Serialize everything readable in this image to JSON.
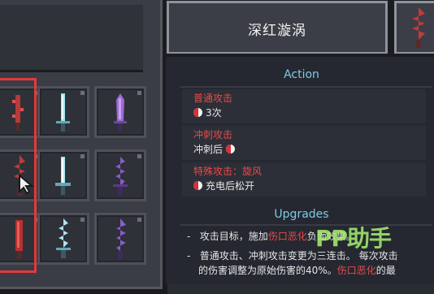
{
  "title": "深红漩涡",
  "action_header": "Action",
  "actions": [
    {
      "title": "普通攻击",
      "desc": "3次",
      "dot_before": true
    },
    {
      "title": "冲刺攻击",
      "desc": "冲刺后",
      "dot_after": true
    },
    {
      "title": "特殊攻击：旋风",
      "desc": "充电后松开",
      "dot_before": true
    }
  ],
  "upgrades_header": "Upgrades",
  "upgrades": [
    {
      "bullet": "-",
      "pre": "攻击目标，施加",
      "red": "伤口恶化",
      "post": "负面效果。"
    },
    {
      "bullet": "-",
      "pre": "普通攻击、冲刺攻击变更为三连击。 每次攻击",
      "red": "",
      "post": ""
    },
    {
      "bullet": "",
      "pre": "的伤害调整为原始伤害的40%。",
      "red": "伤口恶化",
      "post": "的最"
    }
  ],
  "watermark": "PP助手",
  "colors": {
    "accent_red": "#e94a4a",
    "accent_blue": "#7fc9e8",
    "selection_frame": "#e03a3a"
  },
  "inventory": {
    "weapons": [
      {
        "icon": "crimson-blade-icon",
        "color": "#b83a3a"
      },
      {
        "icon": "ice-sword-icon",
        "color": "#9fe4f0"
      },
      {
        "icon": "purple-dagger-icon",
        "color": "#9d6ad6"
      },
      {
        "icon": "crimson-vortex-sword-icon",
        "color": "#c23a3a"
      },
      {
        "icon": "frost-sword-icon",
        "color": "#a8e8f0"
      },
      {
        "icon": "violet-spiral-sword-icon",
        "color": "#8a5ac8"
      },
      {
        "icon": "blood-greatsword-icon",
        "color": "#b83030"
      },
      {
        "icon": "twisted-ice-sword-icon",
        "color": "#b0e0f0"
      },
      {
        "icon": "shadow-serrated-sword-icon",
        "color": "#8d5ad0"
      }
    ]
  }
}
